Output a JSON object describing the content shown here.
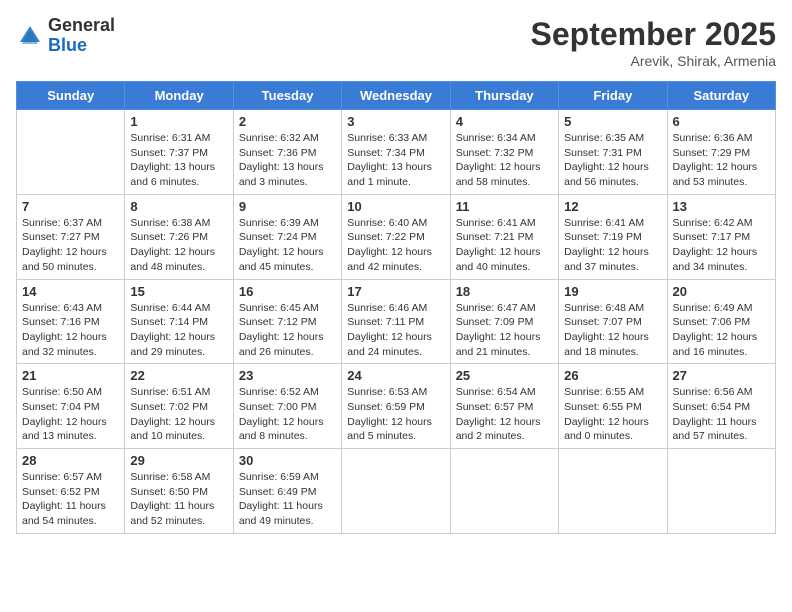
{
  "header": {
    "logo_general": "General",
    "logo_blue": "Blue",
    "month_title": "September 2025",
    "location": "Arevik, Shirak, Armenia"
  },
  "days_of_week": [
    "Sunday",
    "Monday",
    "Tuesday",
    "Wednesday",
    "Thursday",
    "Friday",
    "Saturday"
  ],
  "weeks": [
    [
      {
        "day": "",
        "info": ""
      },
      {
        "day": "1",
        "info": "Sunrise: 6:31 AM\nSunset: 7:37 PM\nDaylight: 13 hours\nand 6 minutes."
      },
      {
        "day": "2",
        "info": "Sunrise: 6:32 AM\nSunset: 7:36 PM\nDaylight: 13 hours\nand 3 minutes."
      },
      {
        "day": "3",
        "info": "Sunrise: 6:33 AM\nSunset: 7:34 PM\nDaylight: 13 hours\nand 1 minute."
      },
      {
        "day": "4",
        "info": "Sunrise: 6:34 AM\nSunset: 7:32 PM\nDaylight: 12 hours\nand 58 minutes."
      },
      {
        "day": "5",
        "info": "Sunrise: 6:35 AM\nSunset: 7:31 PM\nDaylight: 12 hours\nand 56 minutes."
      },
      {
        "day": "6",
        "info": "Sunrise: 6:36 AM\nSunset: 7:29 PM\nDaylight: 12 hours\nand 53 minutes."
      }
    ],
    [
      {
        "day": "7",
        "info": "Sunrise: 6:37 AM\nSunset: 7:27 PM\nDaylight: 12 hours\nand 50 minutes."
      },
      {
        "day": "8",
        "info": "Sunrise: 6:38 AM\nSunset: 7:26 PM\nDaylight: 12 hours\nand 48 minutes."
      },
      {
        "day": "9",
        "info": "Sunrise: 6:39 AM\nSunset: 7:24 PM\nDaylight: 12 hours\nand 45 minutes."
      },
      {
        "day": "10",
        "info": "Sunrise: 6:40 AM\nSunset: 7:22 PM\nDaylight: 12 hours\nand 42 minutes."
      },
      {
        "day": "11",
        "info": "Sunrise: 6:41 AM\nSunset: 7:21 PM\nDaylight: 12 hours\nand 40 minutes."
      },
      {
        "day": "12",
        "info": "Sunrise: 6:41 AM\nSunset: 7:19 PM\nDaylight: 12 hours\nand 37 minutes."
      },
      {
        "day": "13",
        "info": "Sunrise: 6:42 AM\nSunset: 7:17 PM\nDaylight: 12 hours\nand 34 minutes."
      }
    ],
    [
      {
        "day": "14",
        "info": "Sunrise: 6:43 AM\nSunset: 7:16 PM\nDaylight: 12 hours\nand 32 minutes."
      },
      {
        "day": "15",
        "info": "Sunrise: 6:44 AM\nSunset: 7:14 PM\nDaylight: 12 hours\nand 29 minutes."
      },
      {
        "day": "16",
        "info": "Sunrise: 6:45 AM\nSunset: 7:12 PM\nDaylight: 12 hours\nand 26 minutes."
      },
      {
        "day": "17",
        "info": "Sunrise: 6:46 AM\nSunset: 7:11 PM\nDaylight: 12 hours\nand 24 minutes."
      },
      {
        "day": "18",
        "info": "Sunrise: 6:47 AM\nSunset: 7:09 PM\nDaylight: 12 hours\nand 21 minutes."
      },
      {
        "day": "19",
        "info": "Sunrise: 6:48 AM\nSunset: 7:07 PM\nDaylight: 12 hours\nand 18 minutes."
      },
      {
        "day": "20",
        "info": "Sunrise: 6:49 AM\nSunset: 7:06 PM\nDaylight: 12 hours\nand 16 minutes."
      }
    ],
    [
      {
        "day": "21",
        "info": "Sunrise: 6:50 AM\nSunset: 7:04 PM\nDaylight: 12 hours\nand 13 minutes."
      },
      {
        "day": "22",
        "info": "Sunrise: 6:51 AM\nSunset: 7:02 PM\nDaylight: 12 hours\nand 10 minutes."
      },
      {
        "day": "23",
        "info": "Sunrise: 6:52 AM\nSunset: 7:00 PM\nDaylight: 12 hours\nand 8 minutes."
      },
      {
        "day": "24",
        "info": "Sunrise: 6:53 AM\nSunset: 6:59 PM\nDaylight: 12 hours\nand 5 minutes."
      },
      {
        "day": "25",
        "info": "Sunrise: 6:54 AM\nSunset: 6:57 PM\nDaylight: 12 hours\nand 2 minutes."
      },
      {
        "day": "26",
        "info": "Sunrise: 6:55 AM\nSunset: 6:55 PM\nDaylight: 12 hours\nand 0 minutes."
      },
      {
        "day": "27",
        "info": "Sunrise: 6:56 AM\nSunset: 6:54 PM\nDaylight: 11 hours\nand 57 minutes."
      }
    ],
    [
      {
        "day": "28",
        "info": "Sunrise: 6:57 AM\nSunset: 6:52 PM\nDaylight: 11 hours\nand 54 minutes."
      },
      {
        "day": "29",
        "info": "Sunrise: 6:58 AM\nSunset: 6:50 PM\nDaylight: 11 hours\nand 52 minutes."
      },
      {
        "day": "30",
        "info": "Sunrise: 6:59 AM\nSunset: 6:49 PM\nDaylight: 11 hours\nand 49 minutes."
      },
      {
        "day": "",
        "info": ""
      },
      {
        "day": "",
        "info": ""
      },
      {
        "day": "",
        "info": ""
      },
      {
        "day": "",
        "info": ""
      }
    ]
  ]
}
